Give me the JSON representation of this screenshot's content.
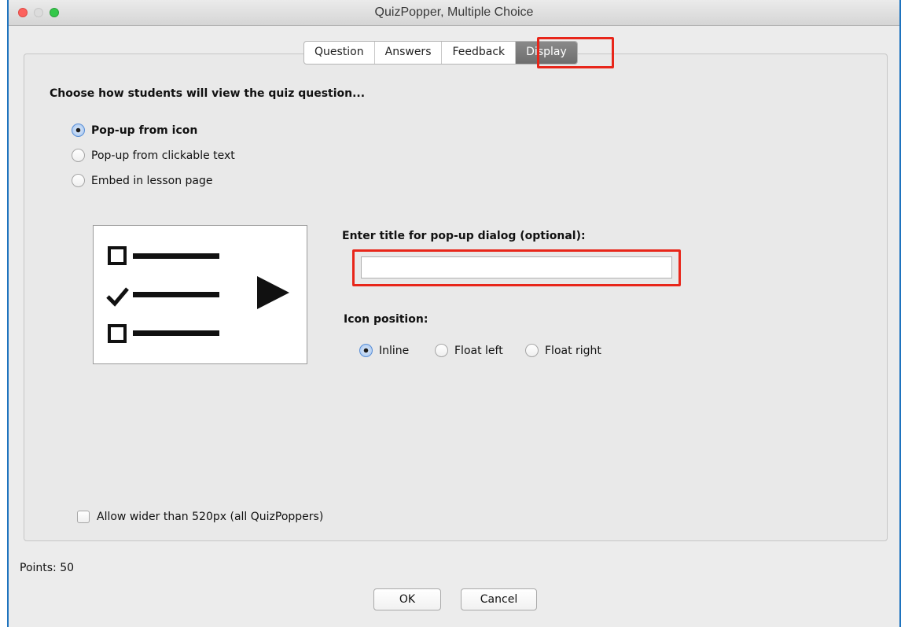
{
  "window": {
    "title": "QuizPopper, Multiple Choice"
  },
  "tabs": [
    {
      "label": "Question",
      "selected": false
    },
    {
      "label": "Answers",
      "selected": false
    },
    {
      "label": "Feedback",
      "selected": false
    },
    {
      "label": "Display",
      "selected": true
    }
  ],
  "display": {
    "heading": "Choose how students will view the quiz question...",
    "view_options": [
      {
        "label": "Pop-up from icon",
        "selected": true
      },
      {
        "label": "Pop-up from clickable text",
        "selected": false
      },
      {
        "label": "Embed in lesson page",
        "selected": false
      }
    ],
    "preview_icon": "quiz-list-play-icon",
    "title_field": {
      "label": "Enter title for pop-up dialog (optional):",
      "value": ""
    },
    "icon_position": {
      "label": "Icon position:",
      "options": [
        {
          "label": "Inline",
          "selected": true
        },
        {
          "label": "Float left",
          "selected": false
        },
        {
          "label": "Float right",
          "selected": false
        }
      ]
    },
    "allow_wider": {
      "label": "Allow wider than 520px (all QuizPoppers)",
      "checked": false
    }
  },
  "footer": {
    "points": "Points: 50",
    "ok": "OK",
    "cancel": "Cancel"
  },
  "colors": {
    "highlight": "#e8261a",
    "window_border": "#1e73be",
    "selected_tab": "#7a7a7a"
  }
}
